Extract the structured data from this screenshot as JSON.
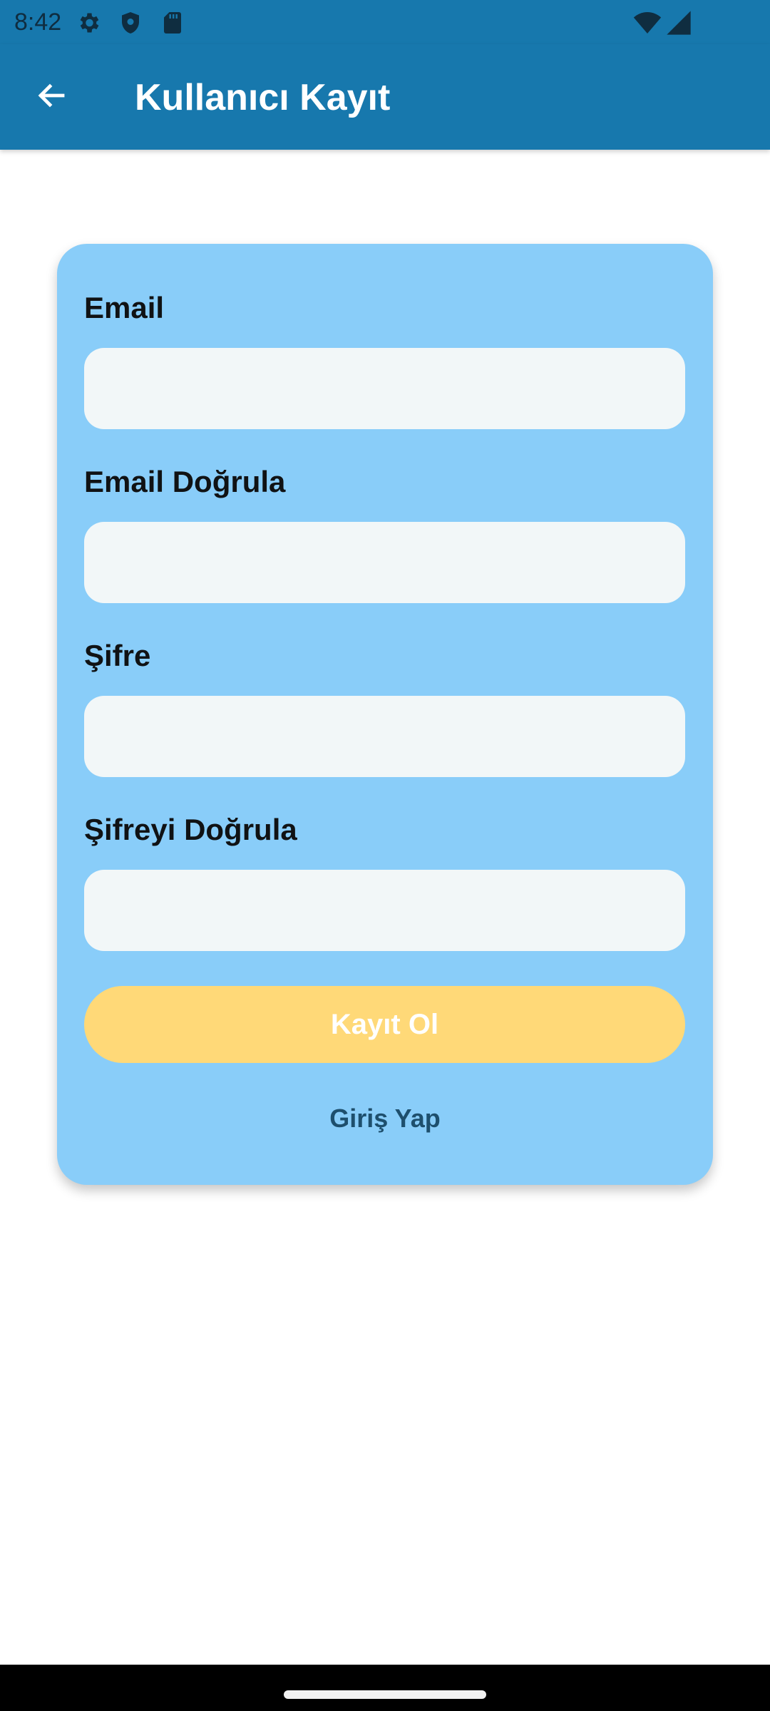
{
  "status_bar": {
    "time": "8:42",
    "icons": [
      "settings-icon",
      "shield-icon",
      "sd-card-icon",
      "wifi-icon",
      "signal-icon"
    ]
  },
  "app_bar": {
    "title": "Kullanıcı Kayıt",
    "back_icon": "arrow-back-icon"
  },
  "form": {
    "email_label": "Email",
    "email_value": "",
    "email_confirm_label": "Email Doğrula",
    "email_confirm_value": "",
    "password_label": "Şifre",
    "password_value": "",
    "password_confirm_label": "Şifreyi Doğrula",
    "password_confirm_value": "",
    "register_button": "Kayıt Ol",
    "login_link": "Giriş Yap"
  },
  "colors": {
    "app_bar": "#1778ad",
    "card": "#89cdf9",
    "input": "#f2f7f8",
    "button": "#ffd978",
    "link": "#1e4f6d"
  }
}
